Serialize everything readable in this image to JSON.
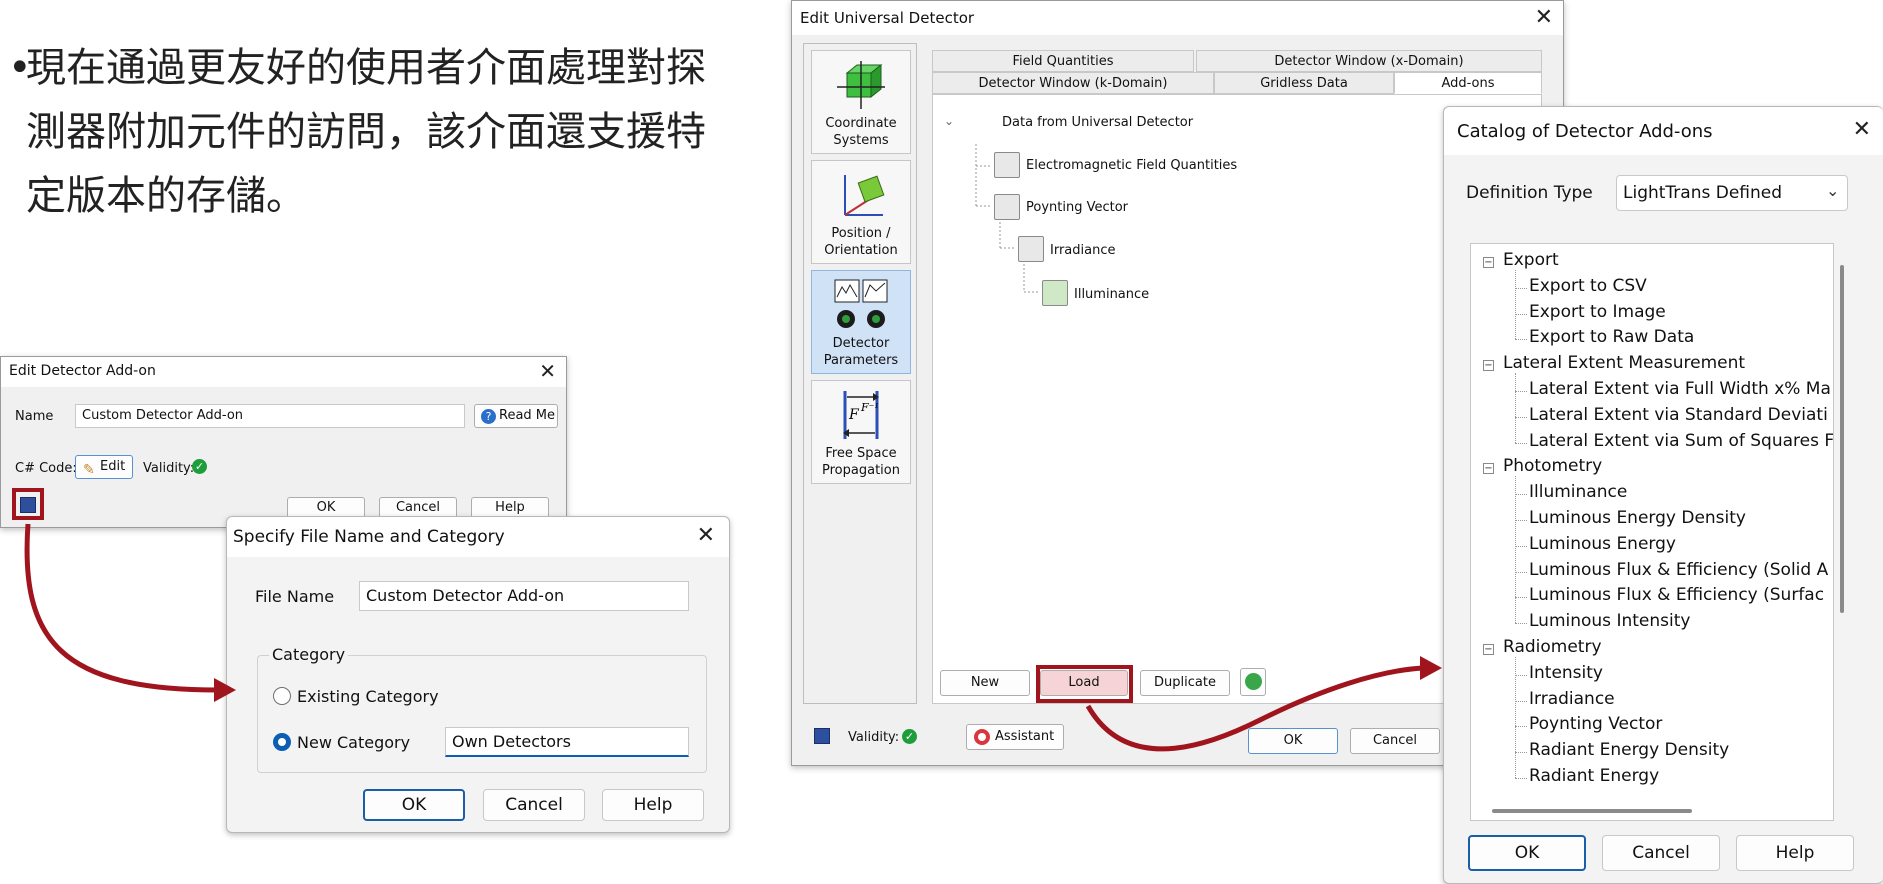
{
  "bullet": {
    "dot": "•",
    "text": "現在通過更友好的使用者介面處理對探測器附加元件的訪問，該介面還支援特定版本的存儲。"
  },
  "edit_addon": {
    "title": "Edit Detector Add-on",
    "name_label": "Name",
    "name_value": "Custom Detector Add-on",
    "read_me": "Read Me",
    "code_label": "C# Code:",
    "edit_label": "Edit",
    "validity_label": "Validity:",
    "ok": "OK",
    "cancel": "Cancel",
    "help": "Help"
  },
  "specify_file": {
    "title": "Specify File Name and Category",
    "file_name_label": "File Name",
    "file_name_value": "Custom Detector Add-on",
    "category_label": "Category",
    "existing_category": "Existing Category",
    "new_category": "New Category",
    "new_category_value": "Own Detectors",
    "ok": "OK",
    "cancel": "Cancel",
    "help": "Help"
  },
  "universal_detector": {
    "title": "Edit Universal Detector",
    "nav": [
      {
        "label": "Coordinate\nSystems"
      },
      {
        "label": "Position /\nOrientation"
      },
      {
        "label": "Detector\nParameters"
      },
      {
        "label": "Free Space\nPropagation"
      }
    ],
    "tabs_row1": [
      "Field Quantities",
      "Detector Window (x-Domain)"
    ],
    "tabs_row2": [
      "Detector Window (k-Domain)",
      "Gridless Data",
      "Add-ons"
    ],
    "tree_root": "Data from Universal Detector",
    "tree": [
      "Electromagnetic Field Quantities",
      "Poynting Vector",
      "Irradiance",
      "Illuminance"
    ],
    "new": "New",
    "load": "Load",
    "duplicate": "Duplicate",
    "validity_label": "Validity:",
    "assistant": "Assistant",
    "ok": "OK",
    "cancel": "Cancel"
  },
  "catalog": {
    "title": "Catalog of Detector Add-ons",
    "definition_type_label": "Definition Type",
    "definition_type_value": "LightTrans Defined",
    "groups": [
      {
        "name": "Export",
        "items": [
          "Export to CSV",
          "Export to Image",
          "Export to Raw Data"
        ]
      },
      {
        "name": "Lateral Extent Measurement",
        "items": [
          "Lateral Extent via Full Width x% Ma",
          "Lateral Extent via Standard Deviati",
          "Lateral Extent via Sum of Squares F"
        ]
      },
      {
        "name": "Photometry",
        "items": [
          "Illuminance",
          "Luminous Energy Density",
          "Luminous Energy",
          "Luminous Flux & Efficiency (Solid A",
          "Luminous Flux & Efficiency (Surfac",
          "Luminous Intensity"
        ]
      },
      {
        "name": "Radiometry",
        "items": [
          "Intensity",
          "Irradiance",
          "Poynting Vector",
          "Radiant Energy Density",
          "Radiant Energy"
        ]
      }
    ],
    "ok": "OK",
    "cancel": "Cancel",
    "help": "Help"
  },
  "colors": {
    "arrow": "#a0141e",
    "accent": "#1a5ea8",
    "valid": "#1e9e3a"
  }
}
